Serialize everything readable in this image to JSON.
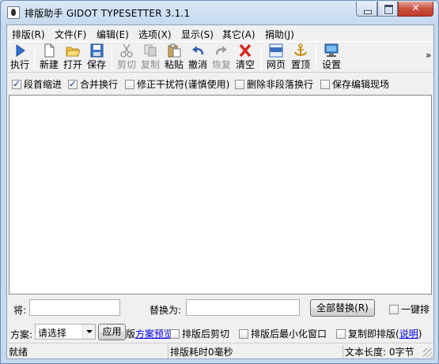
{
  "window": {
    "title": "排版助手 GIDOT TYPESETTER 3.1.1"
  },
  "menu": [
    {
      "label": "排版(R)"
    },
    {
      "label": "文件(F)"
    },
    {
      "label": "编辑(E)"
    },
    {
      "label": "选项(X)"
    },
    {
      "label": "显示(S)"
    },
    {
      "label": "其它(A)"
    },
    {
      "label": "捐助(J)"
    }
  ],
  "toolbar": {
    "run": "执行",
    "new": "新建",
    "open": "打开",
    "save": "保存",
    "cut": "剪切",
    "copy": "复制",
    "paste": "粘贴",
    "undo": "撤消",
    "redo": "恢复",
    "clear": "清空",
    "web": "网页",
    "pin": "置顶",
    "settings": "设置",
    "overflow": "»"
  },
  "options": [
    {
      "label": "段首缩进",
      "checked": true
    },
    {
      "label": "合并换行",
      "checked": true
    },
    {
      "label": "修正干扰符(谨慎使用)",
      "checked": false
    },
    {
      "label": "删除非段落换行",
      "checked": false
    },
    {
      "label": "保存编辑现场",
      "checked": false
    }
  ],
  "editor": {
    "content": ""
  },
  "replace": {
    "from_label": "将:",
    "from_value": "",
    "to_label": "替换为:",
    "to_value": "",
    "replace_all": "全部替换(R)",
    "one_click_label": "一键排"
  },
  "scheme": {
    "label": "方案:",
    "selected": "请选择",
    "apply": "应用",
    "preview_prefix": "版",
    "preview_link": "方案预览",
    "cut_after": "排版后剪切",
    "minimize_after": "排版后最小化窗口",
    "copy_is_typeset": "复制即排版",
    "help_open": "(",
    "help_link": "说明",
    "help_close": ")"
  },
  "status": {
    "ready": "就绪",
    "time": "排版耗时0毫秒",
    "length": "文本长度: 0字节"
  },
  "colors": {
    "titlebar": "#c5d9ef",
    "close_button": "#c8523d",
    "link": "#0000ee"
  }
}
